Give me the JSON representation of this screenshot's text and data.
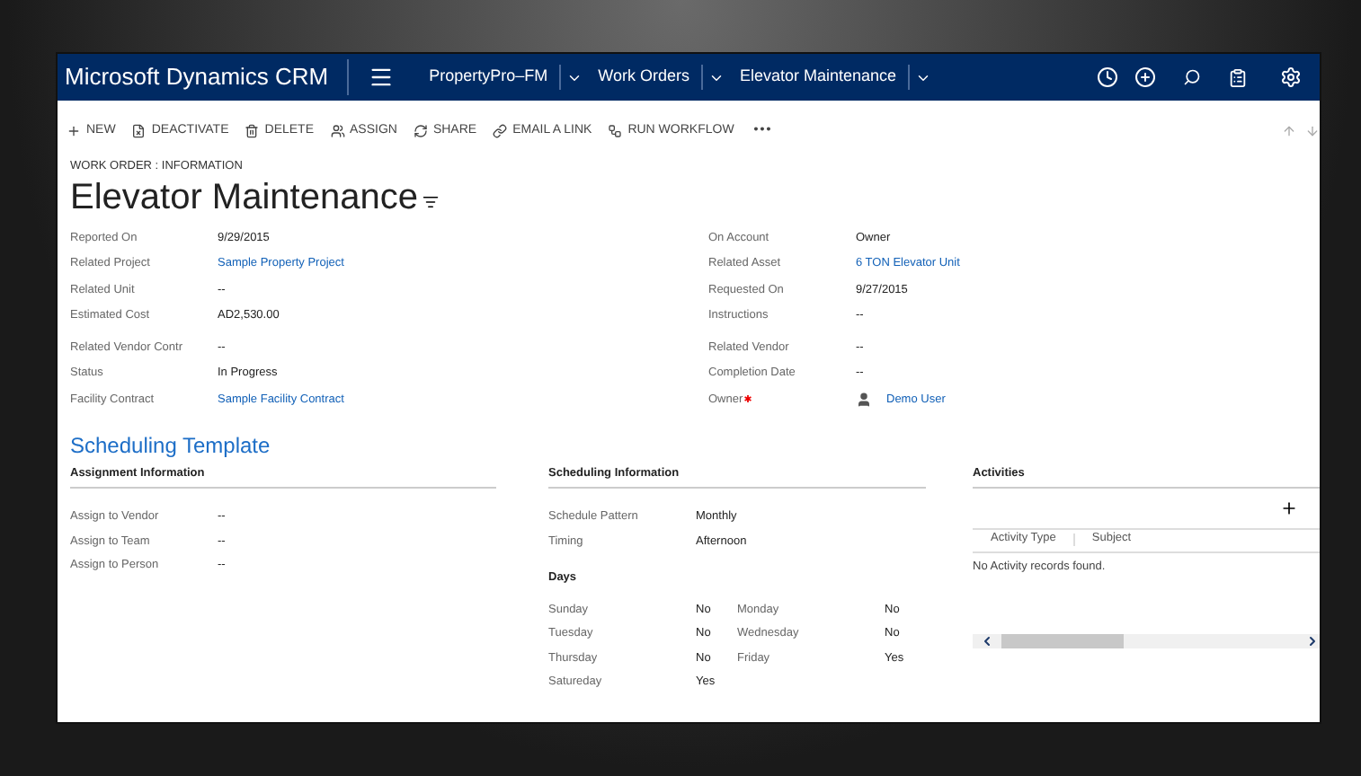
{
  "nav": {
    "app_title": "Microsoft Dynamics CRM",
    "breadcrumbs": [
      {
        "label": "PropertyPro–FM"
      },
      {
        "label": "Work Orders"
      },
      {
        "label": "Elevator Maintenance"
      }
    ]
  },
  "commands": [
    {
      "label": "NEW",
      "kind": "new"
    },
    {
      "label": "DEACTIVATE",
      "kind": "deactivate"
    },
    {
      "label": "DELETE",
      "kind": "delete"
    },
    {
      "label": "ASSIGN",
      "kind": "assign"
    },
    {
      "label": "SHARE",
      "kind": "share"
    },
    {
      "label": "EMAIL A LINK",
      "kind": "email"
    },
    {
      "label": "RUN WORKFLOW",
      "kind": "workflow"
    },
    {
      "label": "•••",
      "kind": "more"
    }
  ],
  "form": {
    "entity_label": "WORK ORDER : INFORMATION",
    "title": "Elevator Maintenance",
    "left_fields": [
      {
        "label": "Reported On",
        "value": "9/29/2015",
        "kind": "text"
      },
      {
        "label": "Related Project",
        "value": "Sample Property Project",
        "kind": "link"
      },
      {
        "label": "Related Unit",
        "value": "--",
        "kind": "text"
      },
      {
        "label": "Estimated Cost",
        "value": "AD2,530.00",
        "kind": "text"
      },
      {
        "label": "Related Vendor Contr",
        "value": "--",
        "kind": "text"
      },
      {
        "label": "Status",
        "value": "In Progress",
        "kind": "text"
      },
      {
        "label": "Facility Contract",
        "value": "Sample Facility Contract",
        "kind": "link"
      }
    ],
    "right_fields": [
      {
        "label": "On Account",
        "value": "Owner",
        "kind": "text",
        "required": false
      },
      {
        "label": "Related Asset",
        "value": "6 TON Elevator Unit",
        "kind": "link",
        "required": false
      },
      {
        "label": "Requested On",
        "value": "9/27/2015",
        "kind": "text",
        "required": false
      },
      {
        "label": "Instructions",
        "value": "--",
        "kind": "text",
        "required": false
      },
      {
        "label": "Related Vendor",
        "value": "--",
        "kind": "text",
        "required": false
      },
      {
        "label": "Completion Date",
        "value": "--",
        "kind": "text",
        "required": false
      },
      {
        "label": "Owner",
        "value": "Demo User",
        "kind": "user",
        "required": true
      }
    ]
  },
  "section_title": "Scheduling Template",
  "assignment": {
    "heading": "Assignment Information",
    "fields": [
      {
        "label": "Assign to Vendor",
        "value": "--"
      },
      {
        "label": "Assign to Team",
        "value": "--"
      },
      {
        "label": "Assign to Person",
        "value": "--"
      }
    ]
  },
  "scheduling": {
    "heading": "Scheduling Information",
    "fields": [
      {
        "label": "Schedule Pattern",
        "value": "Monthly"
      },
      {
        "label": "Timing",
        "value": "Afternoon"
      }
    ],
    "days_heading": "Days",
    "days": [
      {
        "label": "Sunday",
        "value": "No"
      },
      {
        "label": "Monday",
        "value": "No"
      },
      {
        "label": "Tuesday",
        "value": "No"
      },
      {
        "label": "Wednesday",
        "value": "No"
      },
      {
        "label": "Thursday",
        "value": "No"
      },
      {
        "label": "Friday",
        "value": "Yes"
      },
      {
        "label": "Satureday",
        "value": "Yes"
      }
    ]
  },
  "activities": {
    "heading": "Activities",
    "columns": [
      "Activity Type",
      "Subject"
    ],
    "empty": "No Activity records found."
  }
}
